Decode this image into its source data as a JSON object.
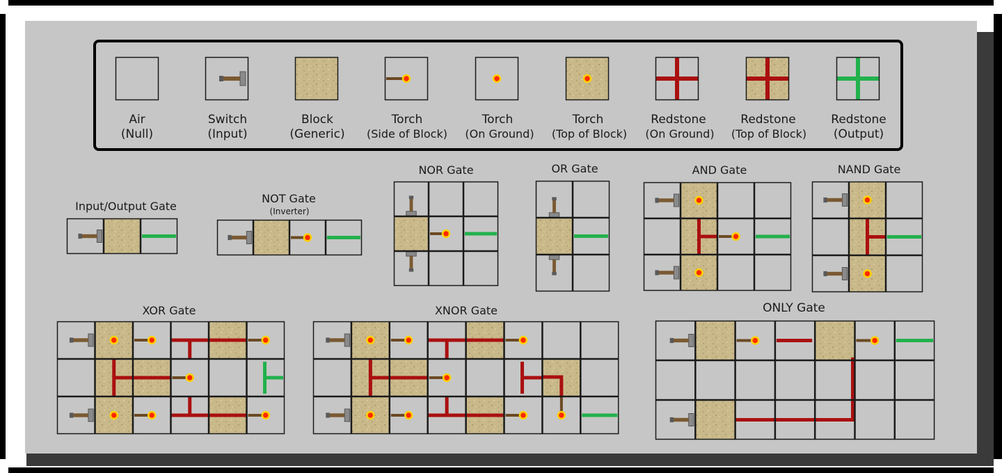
{
  "legend": [
    {
      "name": "Air",
      "sub": "(Null)",
      "tile": "air"
    },
    {
      "name": "Switch",
      "sub": "(Input)",
      "tile": "switch"
    },
    {
      "name": "Block",
      "sub": "(Generic)",
      "tile": "block"
    },
    {
      "name": "Torch",
      "sub": "(Side of Block)",
      "tile": "torch-side"
    },
    {
      "name": "Torch",
      "sub": "(On Ground)",
      "tile": "torch-ground"
    },
    {
      "name": "Torch",
      "sub": "(Top of Block)",
      "tile": "torch-top"
    },
    {
      "name": "Redstone",
      "sub": "(On Ground)",
      "tile": "redstone-ground"
    },
    {
      "name": "Redstone",
      "sub": "(Top of Block)",
      "tile": "redstone-top"
    },
    {
      "name": "Redstone",
      "sub": "(Output)",
      "tile": "redstone-output"
    }
  ],
  "gates": {
    "io": {
      "title": "Input/Output Gate"
    },
    "not": {
      "title": "NOT Gate",
      "subtitle": "(Inverter)"
    },
    "nor": {
      "title": "NOR Gate"
    },
    "or": {
      "title": "OR Gate"
    },
    "and": {
      "title": "AND Gate"
    },
    "nand": {
      "title": "NAND Gate"
    },
    "xor": {
      "title": "XOR Gate"
    },
    "xnor": {
      "title": "XNOR Gate"
    },
    "only": {
      "title": "ONLY Gate"
    }
  },
  "colors": {
    "panel": "#c6c6c6",
    "block": "#c9b98a",
    "redstone": "#aa1010",
    "output": "#22b14c",
    "torch": "#ff2a00",
    "torch_ring": "#ffd200"
  }
}
